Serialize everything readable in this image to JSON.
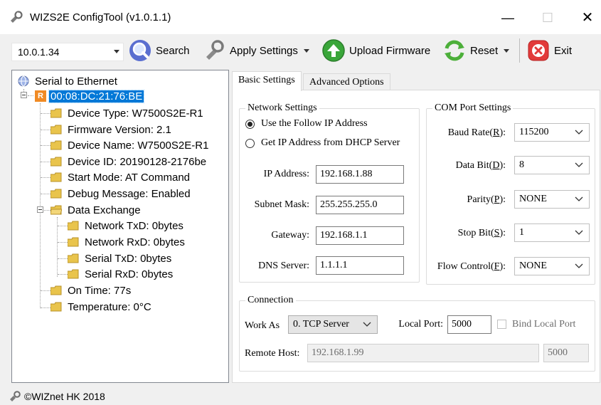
{
  "window": {
    "title": "WIZS2E ConfigTool (v1.0.1.1)",
    "controls": {
      "minimize": "—",
      "maximize": "☐",
      "close": "✕"
    }
  },
  "toolbar": {
    "ip_value": "10.0.1.34",
    "search": "Search",
    "apply_settings": "Apply Settings",
    "upload_firmware": "Upload Firmware",
    "reset": "Reset",
    "exit": "Exit"
  },
  "tree": {
    "root": "Serial to Ethernet",
    "device_badge": "R",
    "device": "00:08:DC:21:76:BE",
    "items": [
      "Device Type: W7500S2E-R1",
      "Firmware Version: 2.1",
      "Device Name: W7500S2E-R1",
      "Device ID: 20190128-2176be",
      "Start Mode: AT Command",
      "Debug Message: Enabled",
      "Data Exchange"
    ],
    "data_exchange": [
      "Network TxD: 0bytes",
      "Network RxD: 0bytes",
      "Serial TxD: 0bytes",
      "Serial RxD: 0bytes"
    ],
    "tail": [
      "On Time: 77s",
      "Temperature: 0°C"
    ]
  },
  "tabs": {
    "basic": "Basic Settings",
    "advanced": "Advanced Options"
  },
  "network": {
    "group_title": "Network Settings",
    "radio_static": "Use the Follow IP Address",
    "radio_dhcp": "Get IP Address from DHCP Server",
    "ip_label": "IP Address:",
    "ip_value": "192.168.1.88",
    "mask_label": "Subnet Mask:",
    "mask_value": "255.255.255.0",
    "gateway_label": "Gateway:",
    "gateway_value": "192.168.1.1",
    "dns_label": "DNS Server:",
    "dns_value": "1.1.1.1"
  },
  "com": {
    "group_title": "COM Port Settings",
    "baud_label": [
      "Baud Rate(",
      "R",
      "):"
    ],
    "baud_value": "115200",
    "databit_label": [
      "Data Bit(",
      "D",
      "):"
    ],
    "databit_value": "8",
    "parity_label": [
      "Parity(",
      "P",
      "):"
    ],
    "parity_value": "NONE",
    "stopbit_label": [
      "Stop Bit(",
      "S",
      "):"
    ],
    "stopbit_value": "1",
    "flow_label": [
      "Flow Control(",
      "F",
      "):"
    ],
    "flow_value": "NONE"
  },
  "connection": {
    "group_title": "Connection",
    "work_as_label": "Work As",
    "work_as_value": "0. TCP Server",
    "local_port_label": "Local Port:",
    "local_port_value": "5000",
    "bind_local_port": "Bind Local Port",
    "remote_host_label": "Remote Host:",
    "remote_host_value": "192.168.1.99",
    "remote_port_value": "5000"
  },
  "status": {
    "text": "©WIZnet HK 2018"
  },
  "colors": {
    "selection": "#0078d7",
    "window_bg": "#f0f0f0",
    "badge": "#f08a24"
  }
}
